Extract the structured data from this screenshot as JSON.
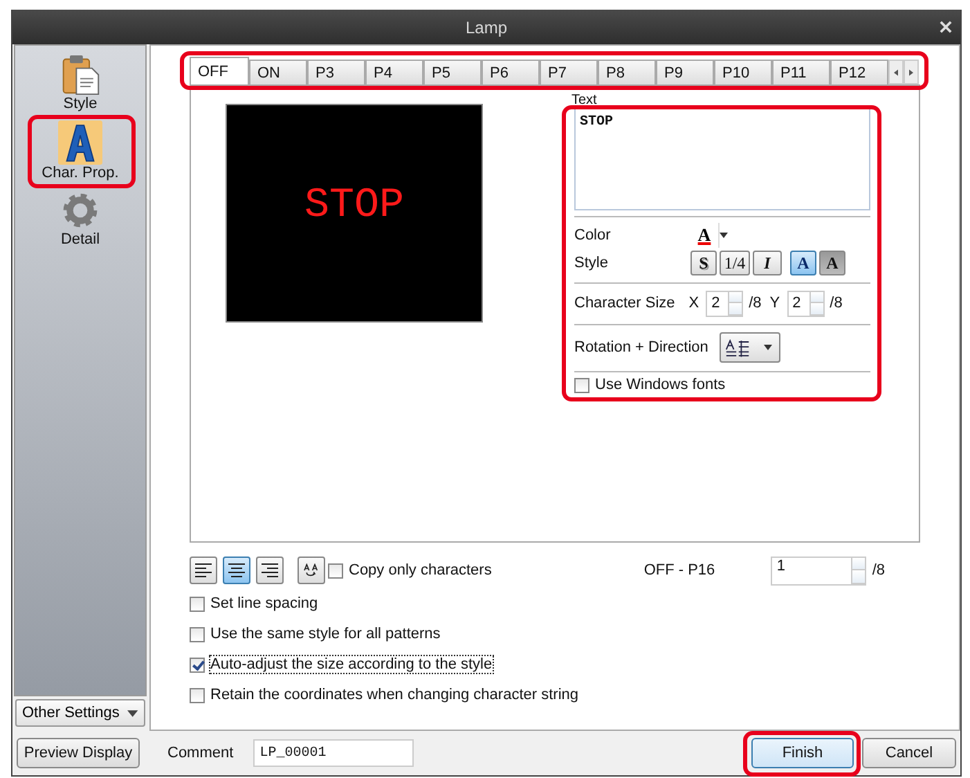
{
  "window": {
    "title": "Lamp"
  },
  "sidebar": {
    "items": [
      {
        "kind": "style",
        "label": "Style",
        "selected": false
      },
      {
        "kind": "char",
        "label": "Char. Prop.",
        "selected": true
      },
      {
        "kind": "detail",
        "label": "Detail",
        "selected": false
      }
    ],
    "other_settings": "Other Settings"
  },
  "tabs": [
    {
      "label": "OFF",
      "selected": true
    },
    {
      "label": "ON",
      "selected": false
    },
    {
      "label": "P3",
      "selected": false
    },
    {
      "label": "P4",
      "selected": false
    },
    {
      "label": "P5",
      "selected": false
    },
    {
      "label": "P6",
      "selected": false
    },
    {
      "label": "P7",
      "selected": false
    },
    {
      "label": "P8",
      "selected": false
    },
    {
      "label": "P9",
      "selected": false
    },
    {
      "label": "P10",
      "selected": false
    },
    {
      "label": "P11",
      "selected": false
    },
    {
      "label": "P12",
      "selected": false
    }
  ],
  "preview": {
    "text": "STOP"
  },
  "text_group": {
    "label": "Text",
    "value": "STOP",
    "color_label": "Color",
    "color_button": "A",
    "style_label": "Style",
    "style_buttons": [
      {
        "kind": "shadow",
        "label": "S",
        "selected": false
      },
      {
        "kind": "fraction",
        "label": "1/4",
        "selected": false
      },
      {
        "kind": "italic",
        "label": "I",
        "selected": false
      },
      {
        "kind": "bold",
        "label": "A",
        "selected": true
      },
      {
        "kind": "shade",
        "label": "A",
        "selected": false
      }
    ],
    "size_label": "Character Size",
    "x_label": "X",
    "x_value": "2",
    "x_max": "/8",
    "y_label": "Y",
    "y_value": "2",
    "y_max": "/8",
    "rotation_label": "Rotation + Direction",
    "windows_fonts": {
      "label": "Use Windows fonts",
      "checked": false
    }
  },
  "toolbar": {
    "align": [
      {
        "kind": "left",
        "selected": false
      },
      {
        "kind": "center",
        "selected": true
      },
      {
        "kind": "right",
        "selected": false
      }
    ],
    "copy_only": {
      "label": "Copy only characters",
      "checked": false
    },
    "range": "OFF - P16",
    "page": "1",
    "page_max": "/8"
  },
  "options": [
    {
      "label": "Set line spacing",
      "checked": false
    },
    {
      "label": "Use the same style for all patterns",
      "checked": false
    },
    {
      "label": "Auto-adjust the size according to the style",
      "checked": true
    },
    {
      "label": "Retain the coordinates when changing character string",
      "checked": false
    }
  ],
  "footer": {
    "preview_button": "Preview Display",
    "comment_label": "Comment",
    "comment": "LP_00001",
    "buttons": [
      {
        "label": "Finish",
        "kind": "primary"
      },
      {
        "label": "Cancel",
        "kind": "normal"
      }
    ]
  }
}
